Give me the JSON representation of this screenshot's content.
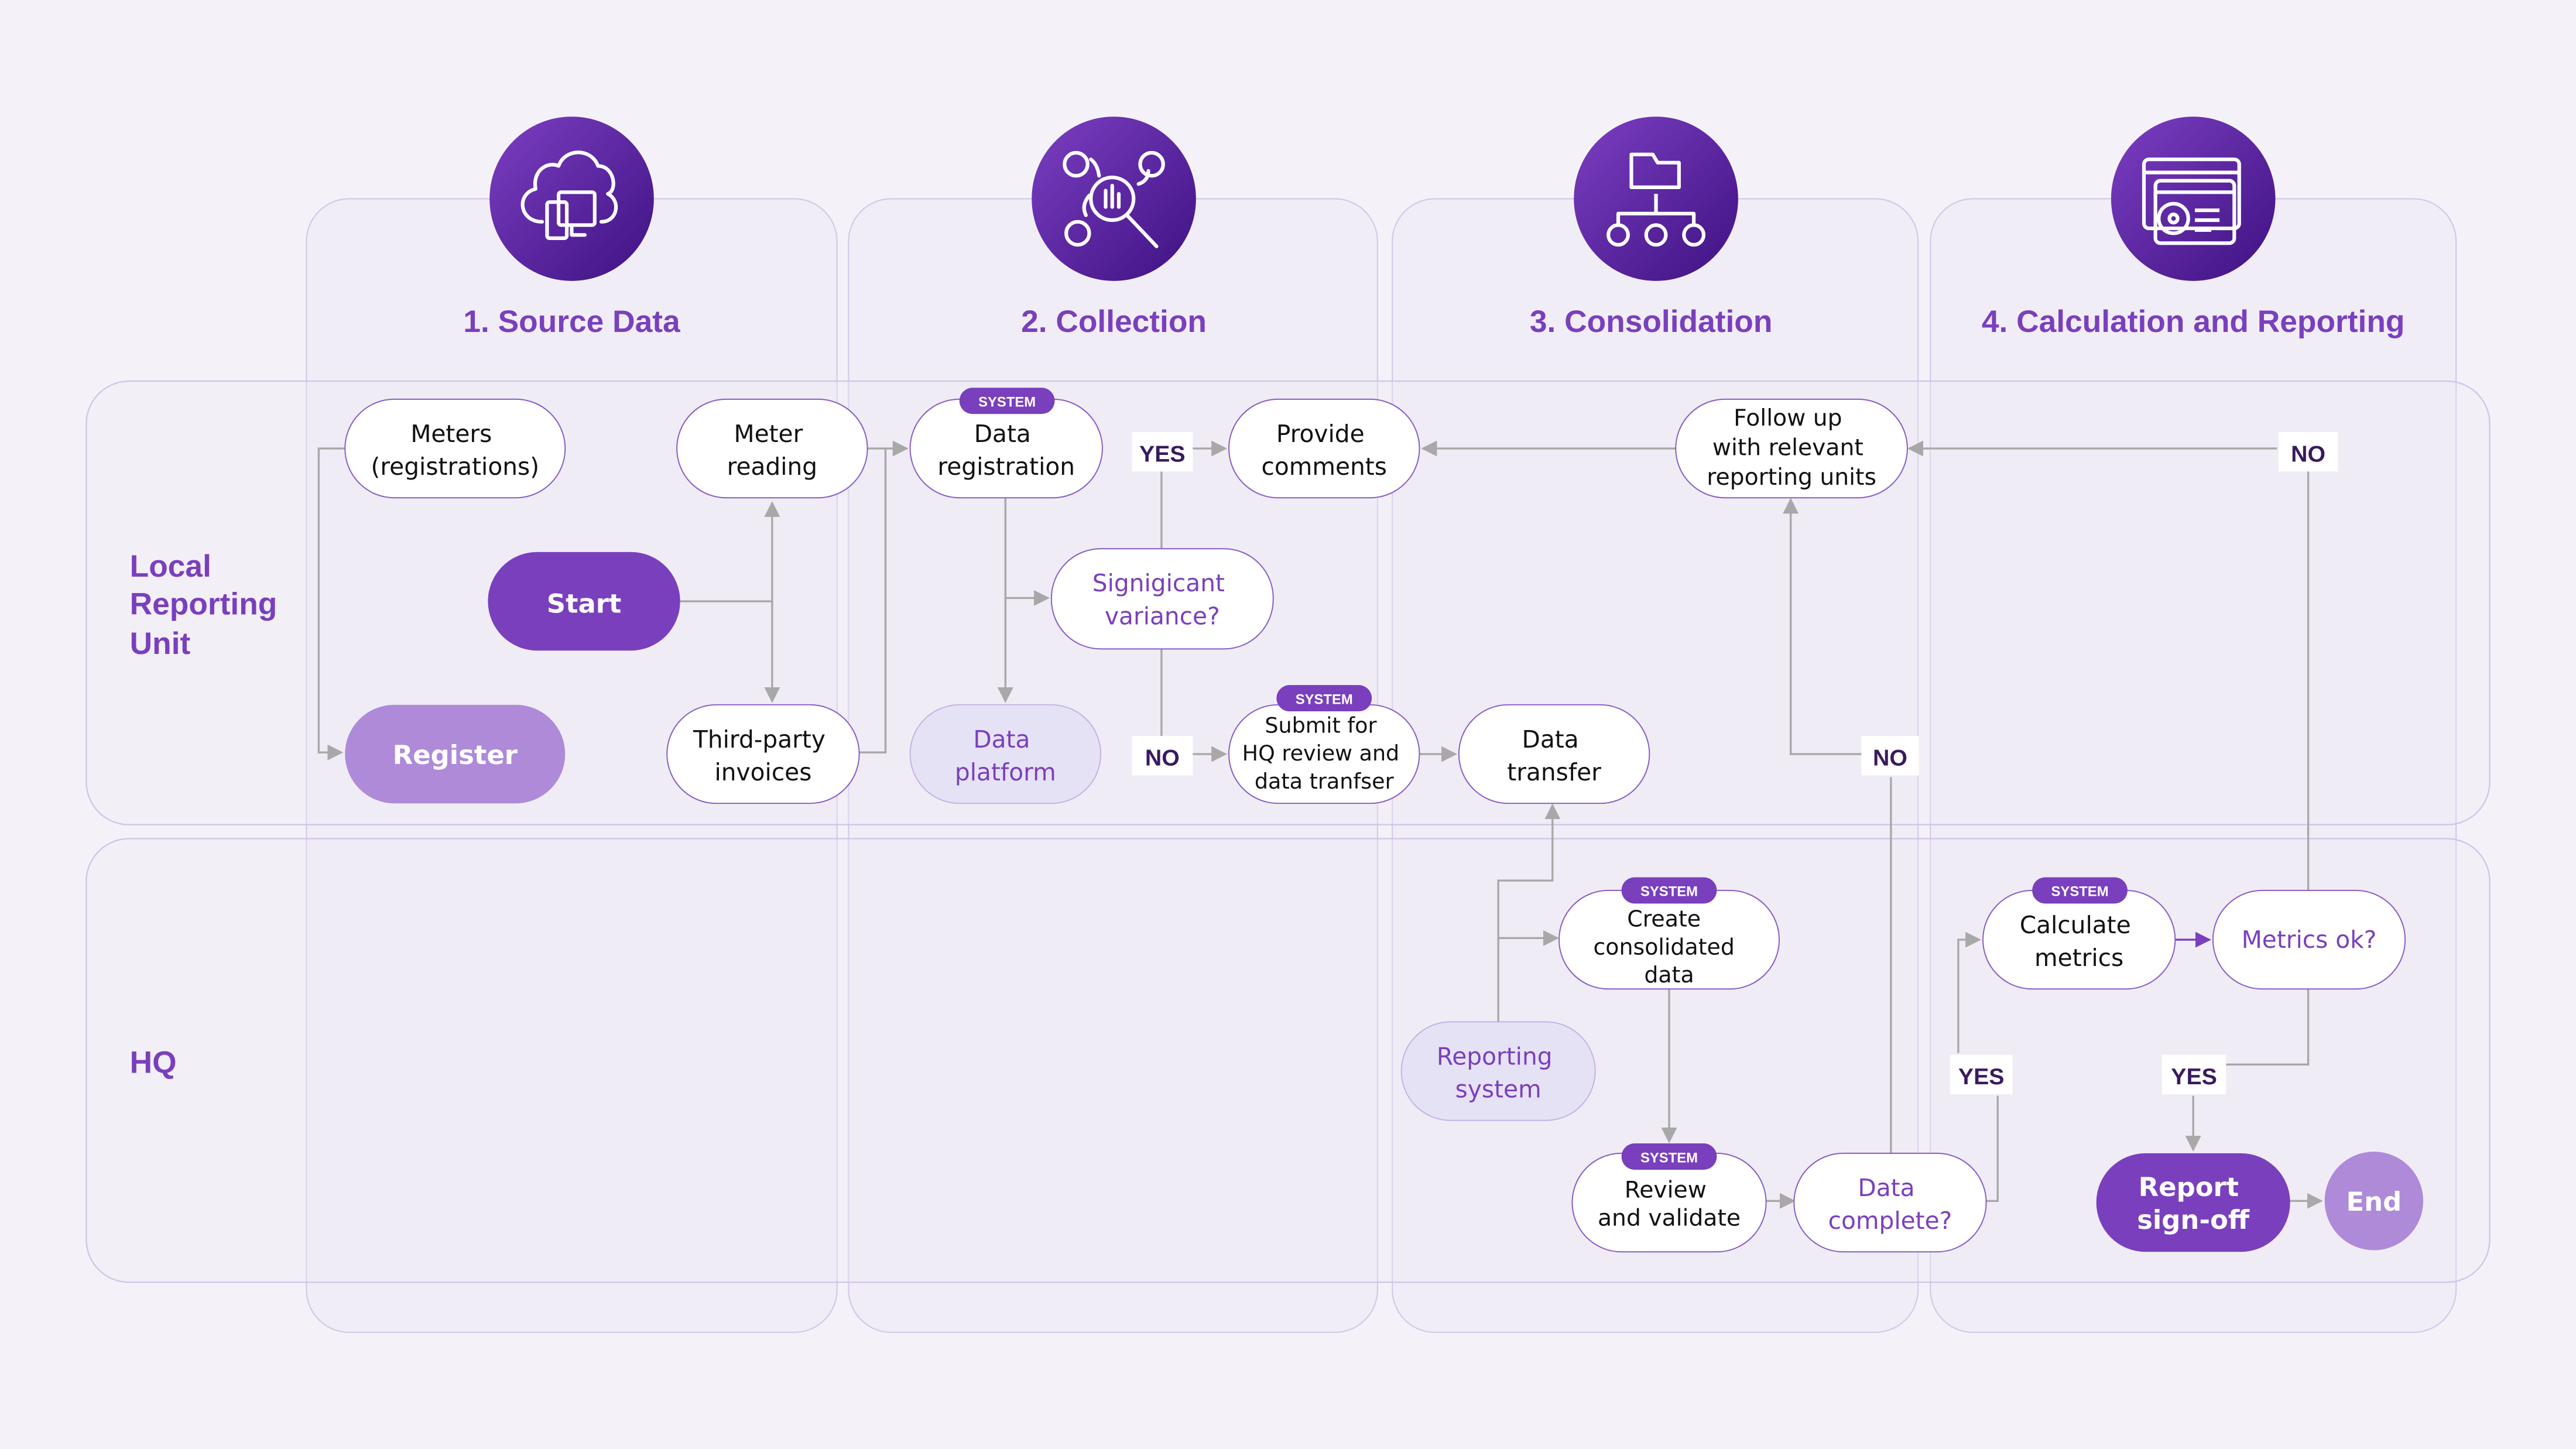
{
  "colors": {
    "background": "#f4f2f8",
    "panel": "#efecf6",
    "panel_border": "#cdb9e6",
    "accent": "#7a3fbd",
    "accent_light": "#ae8ad9",
    "system_fill": "#e6e2f5",
    "connector": "#a8a8a8",
    "condition_text": "#3a1a5e"
  },
  "stages": [
    {
      "id": "source",
      "title": "1. Source Data",
      "icon": "cloud-devices-icon"
    },
    {
      "id": "collection",
      "title": "2. Collection",
      "icon": "people-search-analytics-icon"
    },
    {
      "id": "consolidation",
      "title": "3. Consolidation",
      "icon": "folder-hierarchy-icon"
    },
    {
      "id": "calc",
      "title": "4. Calculation and Reporting",
      "icon": "dashboard-windows-icon"
    }
  ],
  "lanes": [
    {
      "id": "lru",
      "lines": [
        "Local",
        "Reporting",
        "Unit"
      ]
    },
    {
      "id": "hq",
      "lines": [
        "HQ"
      ]
    }
  ],
  "badge_label": "SYSTEM",
  "nodes": {
    "meters": {
      "lines": [
        "Meters",
        "(registrations)"
      ],
      "kind": "process"
    },
    "meter_reading": {
      "lines": [
        "Meter",
        "reading"
      ],
      "kind": "process"
    },
    "start": {
      "lines": [
        "Start"
      ],
      "kind": "start"
    },
    "register": {
      "lines": [
        "Register"
      ],
      "kind": "light"
    },
    "third_party": {
      "lines": [
        "Third-party",
        "invoices"
      ],
      "kind": "process"
    },
    "data_registration": {
      "lines": [
        "Data",
        "registration"
      ],
      "kind": "process",
      "system": true
    },
    "provide_comments": {
      "lines": [
        "Provide",
        "comments"
      ],
      "kind": "process"
    },
    "significant_variance": {
      "lines": [
        "Signigicant",
        "variance?"
      ],
      "kind": "decision"
    },
    "data_platform": {
      "lines": [
        "Data",
        "platform"
      ],
      "kind": "store"
    },
    "submit_hq": {
      "lines": [
        "Submit for",
        "HQ review and",
        "data tranfser"
      ],
      "kind": "process",
      "system": true
    },
    "data_transfer": {
      "lines": [
        "Data",
        "transfer"
      ],
      "kind": "process"
    },
    "follow_up": {
      "lines": [
        "Follow up",
        "with relevant",
        "reporting units"
      ],
      "kind": "process"
    },
    "create_consolidated": {
      "lines": [
        "Create",
        "consolidated",
        "data"
      ],
      "kind": "process",
      "system": true
    },
    "reporting_system": {
      "lines": [
        "Reporting",
        "system"
      ],
      "kind": "store"
    },
    "review_validate": {
      "lines": [
        "Review",
        "and validate"
      ],
      "kind": "process",
      "system": true
    },
    "data_complete": {
      "lines": [
        "Data",
        "complete?"
      ],
      "kind": "decision"
    },
    "calculate_metrics": {
      "lines": [
        "Calculate",
        "metrics"
      ],
      "kind": "process",
      "system": true
    },
    "metrics_ok": {
      "lines": [
        "Metrics ok?"
      ],
      "kind": "decision"
    },
    "report_signoff": {
      "lines": [
        "Report",
        "sign-off"
      ],
      "kind": "start"
    },
    "end": {
      "lines": [
        "End"
      ],
      "kind": "end"
    }
  },
  "conditions": {
    "yes_variance": "YES",
    "no_variance": "NO",
    "no_complete": "NO",
    "no_metrics": "NO",
    "yes_complete": "YES",
    "yes_metrics": "YES"
  }
}
